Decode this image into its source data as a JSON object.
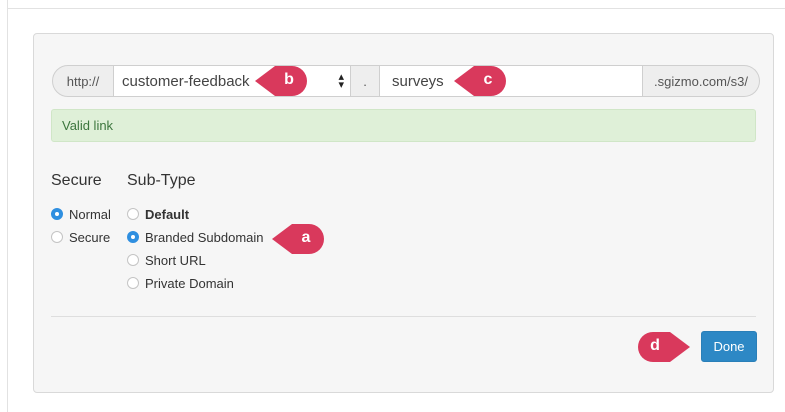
{
  "url": {
    "protocol": "http://",
    "subdomain_value": "customer-feedback",
    "separator": ".",
    "path_value": "surveys",
    "domain_suffix": ".sgizmo.com/s3/"
  },
  "validation": {
    "message": "Valid link"
  },
  "secure": {
    "heading": "Secure",
    "options": [
      {
        "label": "Normal",
        "selected": true
      },
      {
        "label": "Secure",
        "selected": false
      }
    ]
  },
  "subtype": {
    "heading": "Sub-Type",
    "options": [
      {
        "label": "Default",
        "selected": false
      },
      {
        "label": "Branded Subdomain",
        "selected": true
      },
      {
        "label": "Short URL",
        "selected": false
      },
      {
        "label": "Private Domain",
        "selected": false
      }
    ]
  },
  "actions": {
    "done_label": "Done"
  },
  "annotations": {
    "a": "a",
    "b": "b",
    "c": "c",
    "d": "d"
  },
  "colors": {
    "marker": "#d9395c",
    "accent": "#2f8fe0",
    "button": "#2d88c5",
    "success_bg": "#dff0d8"
  }
}
